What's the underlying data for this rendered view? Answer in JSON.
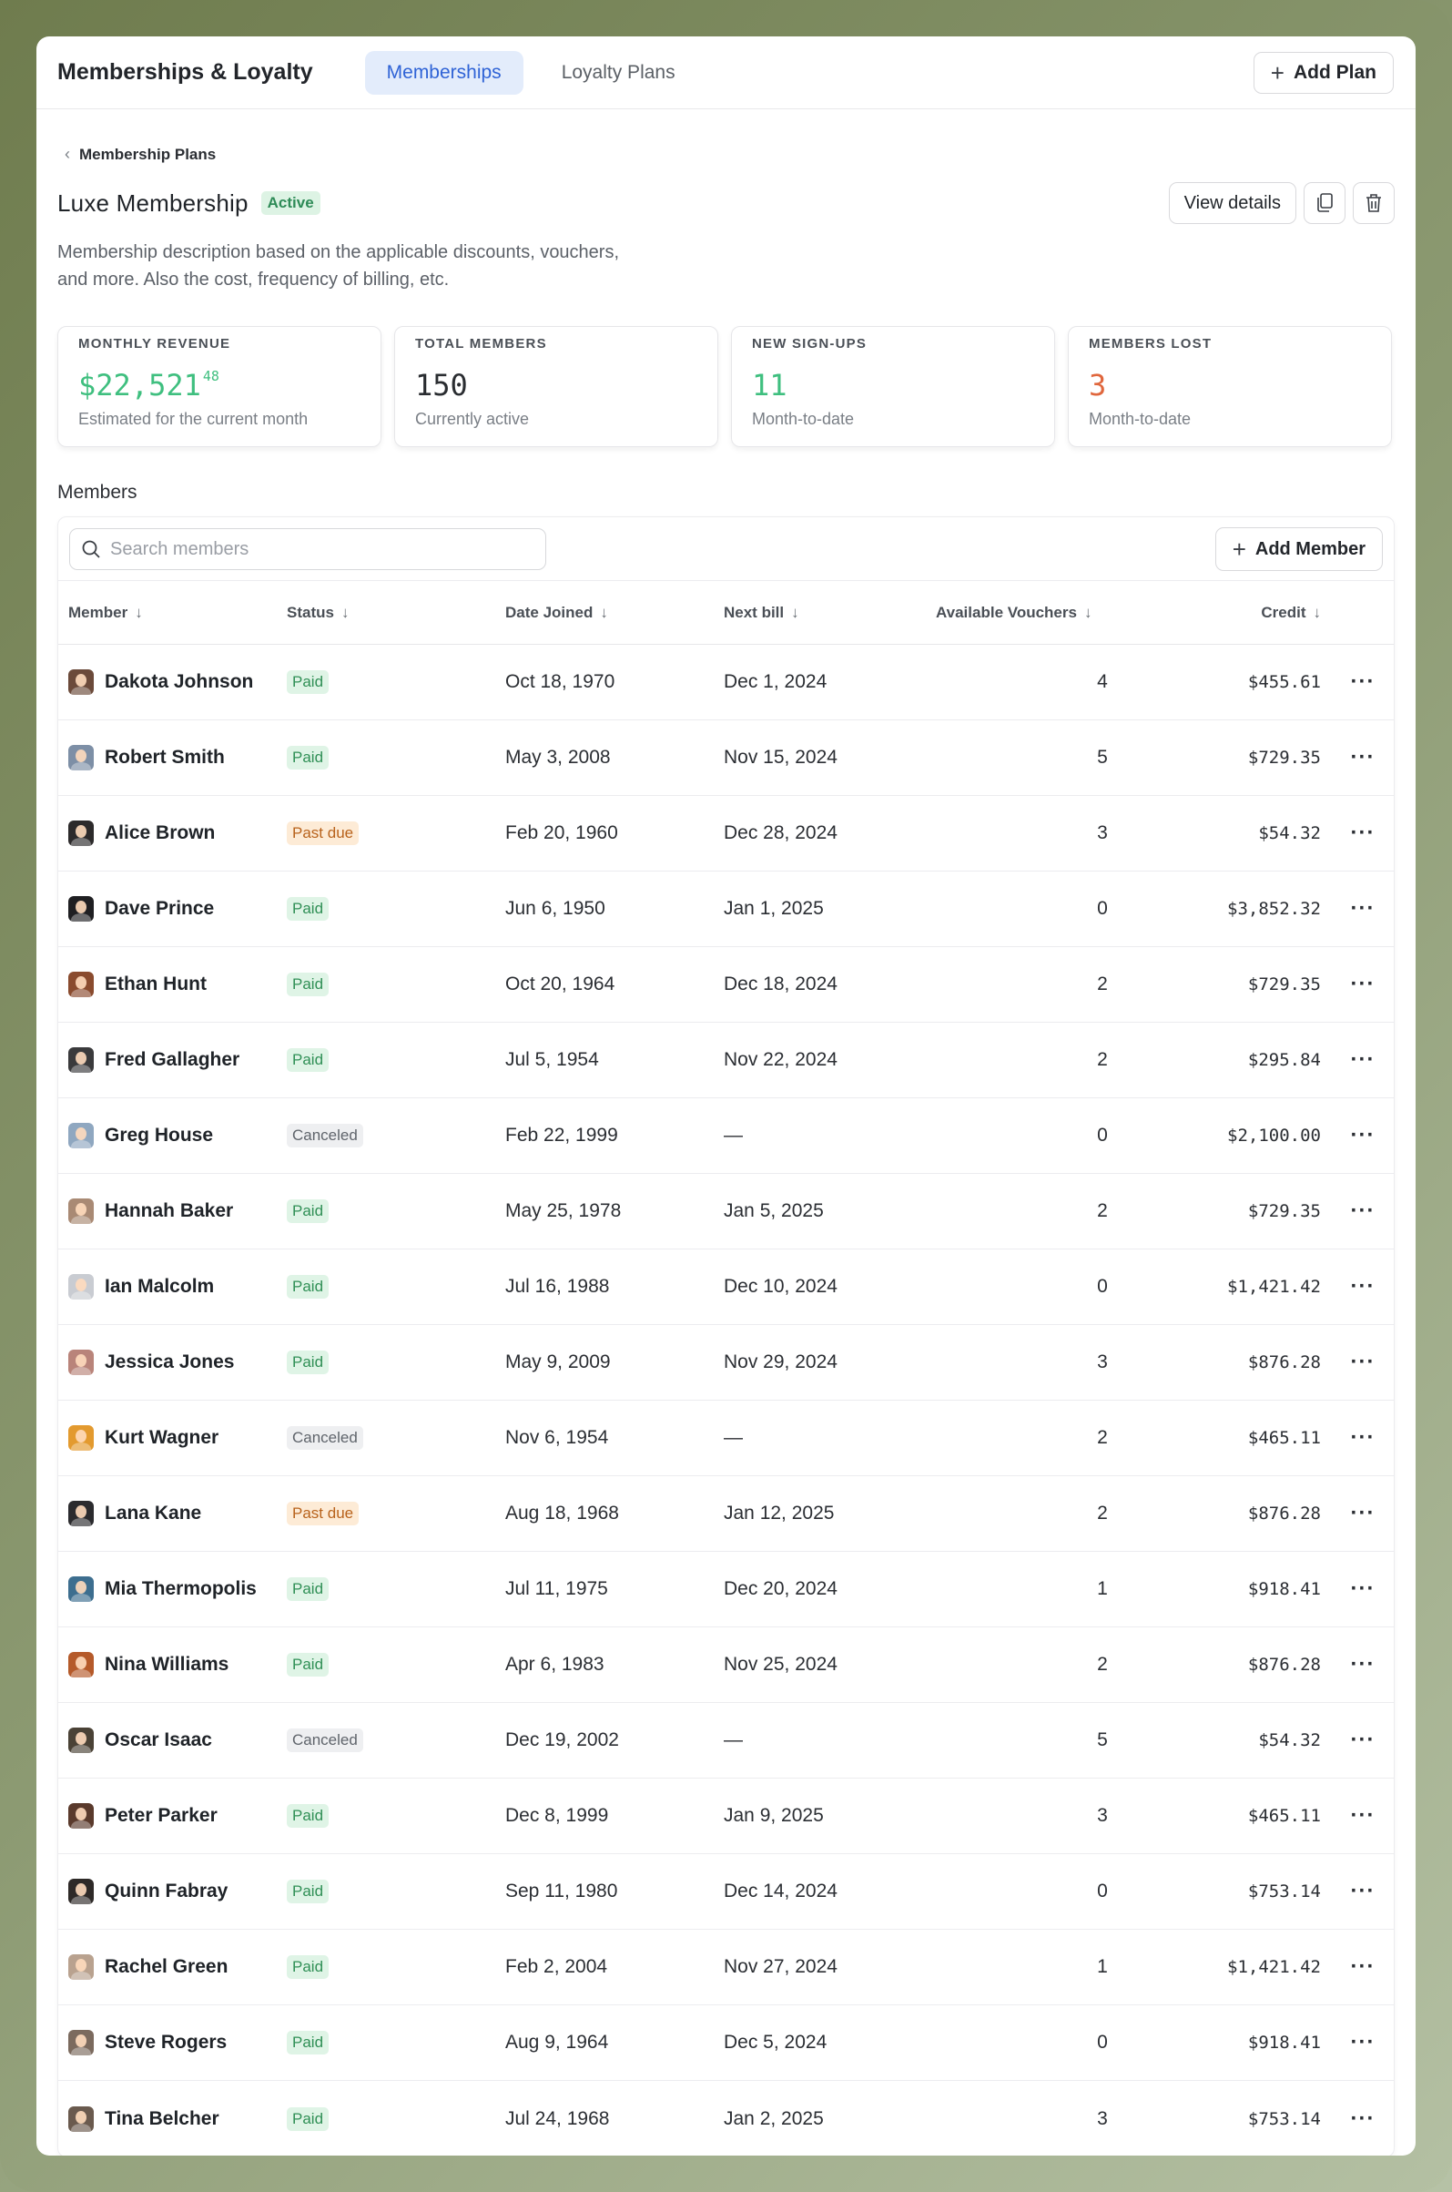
{
  "header": {
    "app_title": "Memberships & Loyalty",
    "tabs": [
      "Memberships",
      "Loyalty Plans"
    ],
    "active_tab": "Memberships",
    "add_plan_label": "Add Plan"
  },
  "breadcrumb": {
    "label": "Membership Plans"
  },
  "plan": {
    "title": "Luxe Membership",
    "status": "Active",
    "description": "Membership description based on the applicable discounts, vouchers, and more. Also the cost, frequency of billing, etc.",
    "view_details_label": "View details"
  },
  "stats": [
    {
      "label": "MONTHLY REVENUE",
      "value": "$22,521",
      "cents": "48",
      "sub": "Estimated for the current month",
      "color": "#3fbf7f"
    },
    {
      "label": "TOTAL MEMBERS",
      "value": "150",
      "cents": "",
      "sub": "Currently active",
      "color": "#2a2d31"
    },
    {
      "label": "NEW SIGN-UPS",
      "value": "11",
      "cents": "",
      "sub": "Month-to-date",
      "color": "#3fbf7f"
    },
    {
      "label": "MEMBERS LOST",
      "value": "3",
      "cents": "",
      "sub": "Month-to-date",
      "color": "#e0663c"
    }
  ],
  "members": {
    "heading": "Members",
    "search_placeholder": "Search members",
    "add_member_label": "Add Member",
    "columns": [
      "Member",
      "Status",
      "Date Joined",
      "Next bill",
      "Available Vouchers",
      "Credit"
    ],
    "rows": [
      {
        "name": "Dakota Johnson",
        "status": "Paid",
        "joined": "Oct 18, 1970",
        "next": "Dec 1, 2024",
        "vouchers": "4",
        "credit": "$455.61",
        "avatar": "#6b4a3a"
      },
      {
        "name": "Robert Smith",
        "status": "Paid",
        "joined": "May 3, 2008",
        "next": "Nov 15, 2024",
        "vouchers": "5",
        "credit": "$729.35",
        "avatar": "#7d8fa6"
      },
      {
        "name": "Alice Brown",
        "status": "Past due",
        "joined": "Feb 20, 1960",
        "next": "Dec 28, 2024",
        "vouchers": "3",
        "credit": "$54.32",
        "avatar": "#2c2a2b"
      },
      {
        "name": "Dave Prince",
        "status": "Paid",
        "joined": "Jun 6, 1950",
        "next": "Jan 1, 2025",
        "vouchers": "0",
        "credit": "$3,852.32",
        "avatar": "#1f1f22"
      },
      {
        "name": "Ethan Hunt",
        "status": "Paid",
        "joined": "Oct 20, 1964",
        "next": "Dec 18, 2024",
        "vouchers": "2",
        "credit": "$729.35",
        "avatar": "#8a4b2e"
      },
      {
        "name": "Fred Gallagher",
        "status": "Paid",
        "joined": "Jul 5, 1954",
        "next": "Nov 22, 2024",
        "vouchers": "2",
        "credit": "$295.84",
        "avatar": "#3a3a3c"
      },
      {
        "name": "Greg House",
        "status": "Canceled",
        "joined": "Feb 22, 1999",
        "next": "—",
        "vouchers": "0",
        "credit": "$2,100.00",
        "avatar": "#8fa7c0"
      },
      {
        "name": "Hannah Baker",
        "status": "Paid",
        "joined": "May 25, 1978",
        "next": "Jan 5, 2025",
        "vouchers": "2",
        "credit": "$729.35",
        "avatar": "#a98a74"
      },
      {
        "name": "Ian Malcolm",
        "status": "Paid",
        "joined": "Jul 16, 1988",
        "next": "Dec 10, 2024",
        "vouchers": "0",
        "credit": "$1,421.42",
        "avatar": "#c9ccd2"
      },
      {
        "name": "Jessica Jones",
        "status": "Paid",
        "joined": "May 9, 2009",
        "next": "Nov 29, 2024",
        "vouchers": "3",
        "credit": "$876.28",
        "avatar": "#b9847a"
      },
      {
        "name": "Kurt Wagner",
        "status": "Canceled",
        "joined": "Nov 6, 1954",
        "next": "—",
        "vouchers": "2",
        "credit": "$465.11",
        "avatar": "#e39a2f"
      },
      {
        "name": "Lana Kane",
        "status": "Past due",
        "joined": "Aug 18, 1968",
        "next": "Jan 12, 2025",
        "vouchers": "2",
        "credit": "$876.28",
        "avatar": "#2b2b2e"
      },
      {
        "name": "Mia Thermopolis",
        "status": "Paid",
        "joined": "Jul 11, 1975",
        "next": "Dec 20, 2024",
        "vouchers": "1",
        "credit": "$918.41",
        "avatar": "#3d6e8f"
      },
      {
        "name": "Nina Williams",
        "status": "Paid",
        "joined": "Apr 6, 1983",
        "next": "Nov 25, 2024",
        "vouchers": "2",
        "credit": "$876.28",
        "avatar": "#b55a2a"
      },
      {
        "name": "Oscar Isaac",
        "status": "Canceled",
        "joined": "Dec 19, 2002",
        "next": "—",
        "vouchers": "5",
        "credit": "$54.32",
        "avatar": "#4a4236"
      },
      {
        "name": "Peter Parker",
        "status": "Paid",
        "joined": "Dec 8, 1999",
        "next": "Jan 9, 2025",
        "vouchers": "3",
        "credit": "$465.11",
        "avatar": "#5a3a2c"
      },
      {
        "name": "Quinn Fabray",
        "status": "Paid",
        "joined": "Sep 11, 1980",
        "next": "Dec 14, 2024",
        "vouchers": "0",
        "credit": "$753.14",
        "avatar": "#2e2a28"
      },
      {
        "name": "Rachel Green",
        "status": "Paid",
        "joined": "Feb 2, 2004",
        "next": "Nov 27, 2024",
        "vouchers": "1",
        "credit": "$1,421.42",
        "avatar": "#b9a28f"
      },
      {
        "name": "Steve Rogers",
        "status": "Paid",
        "joined": "Aug 9, 1964",
        "next": "Dec 5, 2024",
        "vouchers": "0",
        "credit": "$918.41",
        "avatar": "#7b6a5e"
      },
      {
        "name": "Tina Belcher",
        "status": "Paid",
        "joined": "Jul 24, 1968",
        "next": "Jan 2, 2025",
        "vouchers": "3",
        "credit": "$753.14",
        "avatar": "#6a5a4e"
      }
    ]
  }
}
